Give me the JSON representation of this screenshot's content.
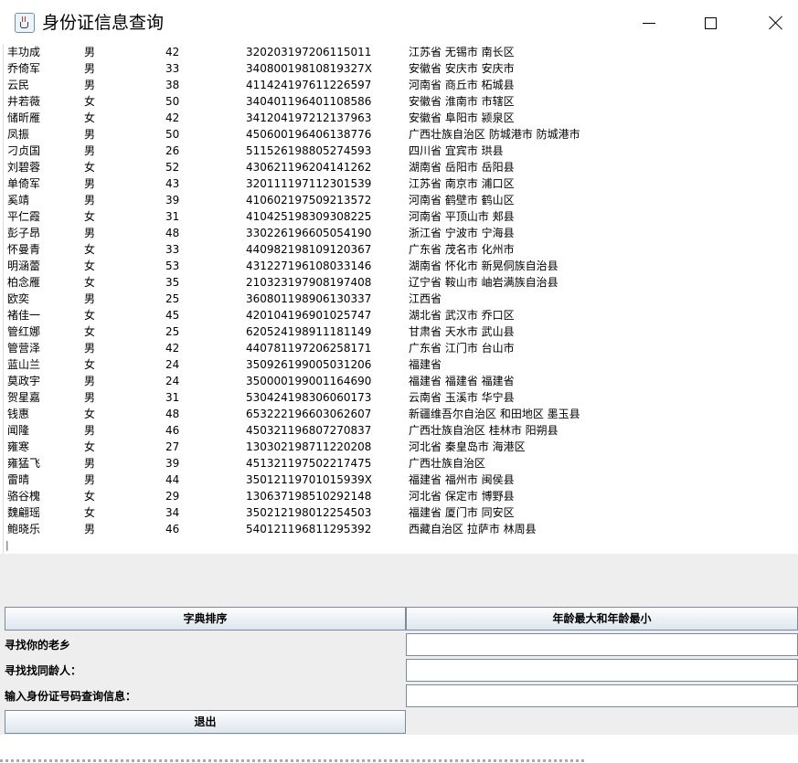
{
  "window": {
    "title": "身份证信息查询",
    "icon": "java-cup-icon"
  },
  "records": [
    {
      "name": "丰功成",
      "gender": "男",
      "age": "42",
      "id": "320203197206115011",
      "address": "江苏省 无锡市 南长区"
    },
    {
      "name": "乔倚军",
      "gender": "男",
      "age": "33",
      "id": "34080019810819327X",
      "address": "安徽省 安庆市 安庆市"
    },
    {
      "name": "云民",
      "gender": "男",
      "age": "38",
      "id": "411424197611226597",
      "address": "河南省 商丘市 柘城县"
    },
    {
      "name": "井若薇",
      "gender": "女",
      "age": "50",
      "id": "340401196401108586",
      "address": "安徽省 淮南市 市辖区"
    },
    {
      "name": "储昕雁",
      "gender": "女",
      "age": "42",
      "id": "341204197212137963",
      "address": "安徽省 阜阳市 颍泉区"
    },
    {
      "name": "凤振",
      "gender": "男",
      "age": "50",
      "id": "450600196406138776",
      "address": "广西壮族自治区 防城港市 防城港市"
    },
    {
      "name": "刁贞国",
      "gender": "男",
      "age": "26",
      "id": "511526198805274593",
      "address": "四川省 宜宾市 珙县"
    },
    {
      "name": "刘碧蓉",
      "gender": "女",
      "age": "52",
      "id": "430621196204141262",
      "address": "湖南省 岳阳市 岳阳县"
    },
    {
      "name": "单倚军",
      "gender": "男",
      "age": "43",
      "id": "320111197112301539",
      "address": "江苏省 南京市 浦口区"
    },
    {
      "name": "奚靖",
      "gender": "男",
      "age": "39",
      "id": "410602197509213572",
      "address": "河南省 鹤壁市 鹤山区"
    },
    {
      "name": "平仁霞",
      "gender": "女",
      "age": "31",
      "id": "410425198309308225",
      "address": "河南省 平顶山市 郏县"
    },
    {
      "name": "彭子昂",
      "gender": "男",
      "age": "48",
      "id": "330226196605054190",
      "address": "浙江省 宁波市 宁海县"
    },
    {
      "name": "怀曼青",
      "gender": "女",
      "age": "33",
      "id": "440982198109120367",
      "address": "广东省 茂名市 化州市"
    },
    {
      "name": "明涵蕾",
      "gender": "女",
      "age": "53",
      "id": "431227196108033146",
      "address": "湖南省 怀化市 新晃侗族自治县"
    },
    {
      "name": "柏念雁",
      "gender": "女",
      "age": "35",
      "id": "210323197908197408",
      "address": "辽宁省 鞍山市 岫岩满族自治县"
    },
    {
      "name": "欧奕",
      "gender": "男",
      "age": "25",
      "id": "360801198906130337",
      "address": "江西省"
    },
    {
      "name": "褚佳一",
      "gender": "女",
      "age": "45",
      "id": "420104196901025747",
      "address": "湖北省 武汉市 乔口区"
    },
    {
      "name": "管红娜",
      "gender": "女",
      "age": "25",
      "id": "620524198911181149",
      "address": "甘肃省 天水市 武山县"
    },
    {
      "name": "管营泽",
      "gender": "男",
      "age": "42",
      "id": "440781197206258171",
      "address": "广东省 江门市 台山市"
    },
    {
      "name": "蓝山兰",
      "gender": "女",
      "age": "24",
      "id": "350926199005031206",
      "address": "福建省"
    },
    {
      "name": "莫政宇",
      "gender": "男",
      "age": "24",
      "id": "350000199001164690",
      "address": "福建省 福建省 福建省"
    },
    {
      "name": "贺星嘉",
      "gender": "男",
      "age": "31",
      "id": "530424198306060173",
      "address": "云南省 玉溪市 华宁县"
    },
    {
      "name": "钱惠",
      "gender": "女",
      "age": "48",
      "id": "653222196603062607",
      "address": "新疆维吾尔自治区 和田地区 墨玉县"
    },
    {
      "name": "闻隆",
      "gender": "男",
      "age": "46",
      "id": "450321196807270837",
      "address": "广西壮族自治区 桂林市 阳朔县"
    },
    {
      "name": "雍寒",
      "gender": "女",
      "age": "27",
      "id": "130302198711220208",
      "address": "河北省 秦皇岛市 海港区"
    },
    {
      "name": "雍猛飞",
      "gender": "男",
      "age": "39",
      "id": "451321197502217475",
      "address": "广西壮族自治区"
    },
    {
      "name": "雷晴",
      "gender": "男",
      "age": "44",
      "id": "35012119701015939X",
      "address": "福建省 福州市 闽侯县"
    },
    {
      "name": "骆谷槐",
      "gender": "女",
      "age": "29",
      "id": "130637198510292148",
      "address": "河北省 保定市 博野县"
    },
    {
      "name": "魏翩瑶",
      "gender": "女",
      "age": "34",
      "id": "350212198012254503",
      "address": "福建省 厦门市 同安区"
    },
    {
      "name": "鲍晓乐",
      "gender": "男",
      "age": "46",
      "id": "540121196811295392",
      "address": "西藏自治区 拉萨市 林周县"
    }
  ],
  "buttons": {
    "sort": "字典排序",
    "age_extremes": "年龄最大和年龄最小",
    "exit": "退出"
  },
  "labels": {
    "hometown": "寻找你的老乡",
    "same_age": "寻找找同龄人：",
    "id_query": "输入身份证号码查询信息："
  },
  "inputs": {
    "hometown": "",
    "same_age": "",
    "id_query": ""
  }
}
